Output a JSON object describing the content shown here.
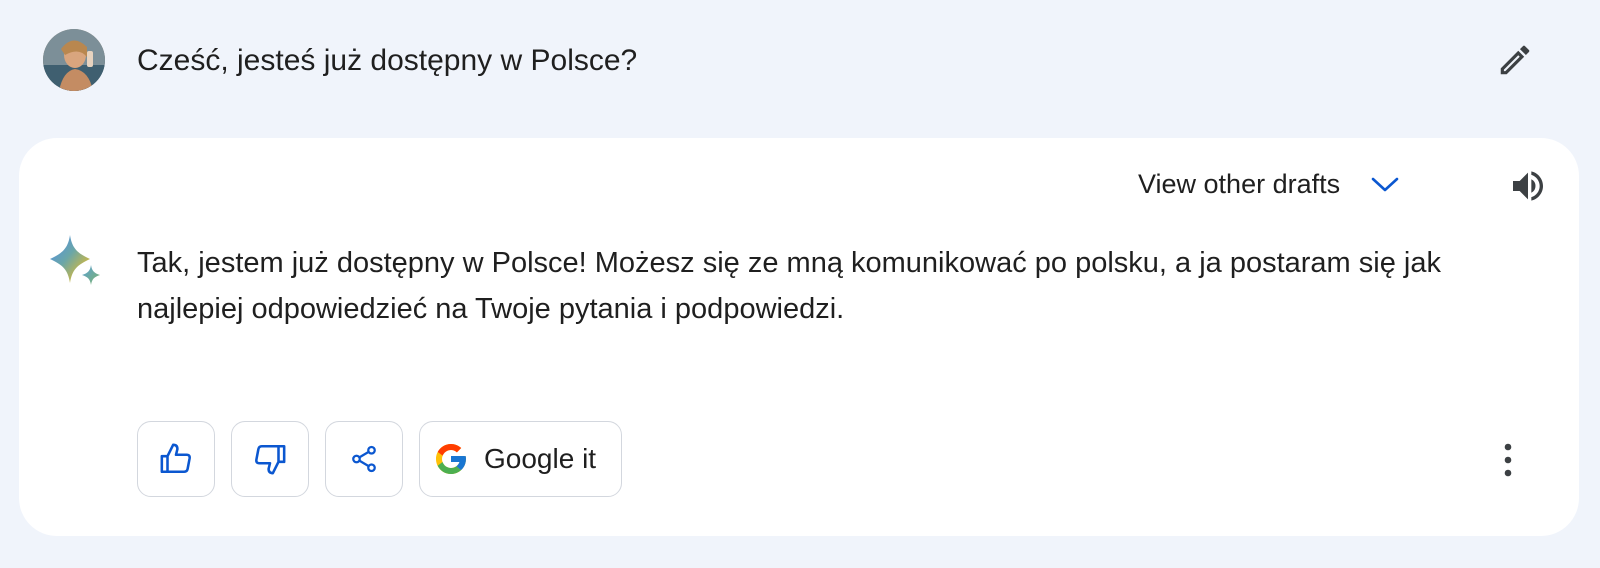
{
  "prompt": {
    "text": "Cześć, jesteś już dostępny w Polsce?",
    "avatar_icon": "user-avatar-photo",
    "edit_icon": "pencil-icon"
  },
  "response": {
    "drafts_label": "View other drafts",
    "drafts_icon": "chevron-down-icon",
    "speaker_icon": "speaker-icon",
    "assistant_icon": "sparkle-icon",
    "text": "Tak, jestem już dostępny w Polsce! Możesz się ze mną komunikować po polsku, a ja postaram się jak najlepiej odpowiedzieć na Twoje pytania i podpowiedzi."
  },
  "actions": {
    "thumbs_up_icon": "thumbs-up-icon",
    "thumbs_down_icon": "thumbs-down-icon",
    "share_icon": "share-icon",
    "google_icon": "google-g-icon",
    "google_label": "Google it",
    "more_icon": "more-vertical-icon"
  },
  "colors": {
    "background": "#f0f4fb",
    "card": "#ffffff",
    "accent": "#0b57d0",
    "text": "#1f1f1f",
    "border": "#d3d7de"
  }
}
